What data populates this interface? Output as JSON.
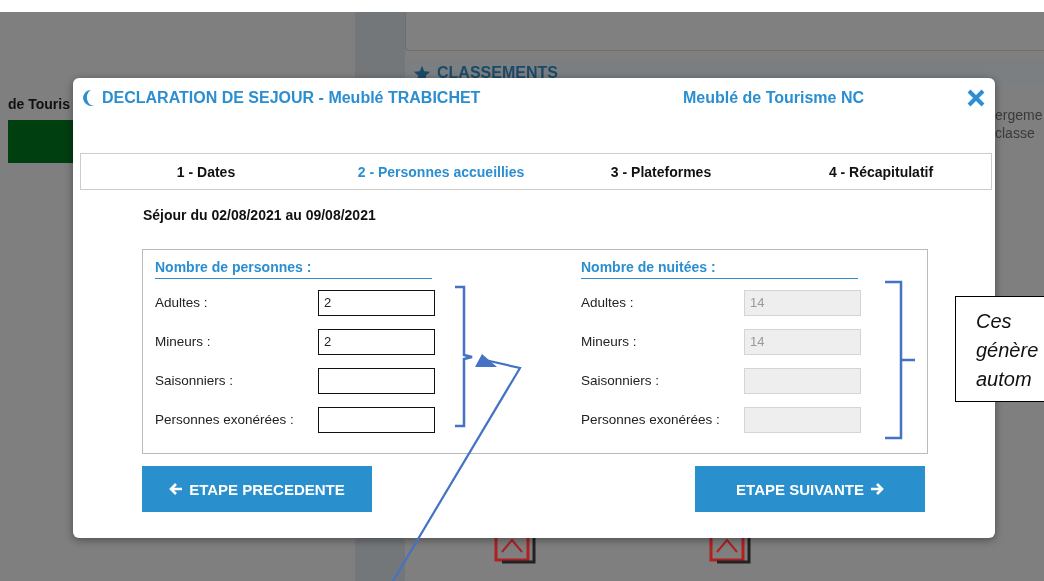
{
  "background": {
    "side_text": "de Touris",
    "section_title": "CLASSEMENTS",
    "side_lines": [
      "ergeme",
      "classe"
    ]
  },
  "dialog": {
    "title": "DECLARATION DE SEJOUR - Meublé TRABICHET",
    "subtitle": "Meublé de Tourisme NC",
    "steps": [
      {
        "label": "1 - Dates",
        "selected": false
      },
      {
        "label": "2 - Personnes accueillies",
        "selected": true
      },
      {
        "label": "3 - Plateformes",
        "selected": false
      },
      {
        "label": "4 - Récapitulatif",
        "selected": false
      }
    ],
    "stay": "Séjour du 02/08/2021 au 09/08/2021",
    "groups": [
      {
        "title": "Nombre de personnes :",
        "disabled": false,
        "fields": [
          {
            "label": "Adultes :",
            "value": "2"
          },
          {
            "label": "Mineurs :",
            "value": "2"
          },
          {
            "label": "Saisonniers :"
          },
          {
            "label": "Personnes exonérées :"
          }
        ]
      },
      {
        "title": "Nombre de nuitées :",
        "disabled": true,
        "fields": [
          {
            "label": "Adultes :",
            "value": "14"
          },
          {
            "label": "Mineurs :",
            "value": "14"
          },
          {
            "label": "Saisonniers :"
          },
          {
            "label": "Personnes exonérées :"
          }
        ]
      }
    ],
    "buttons": [
      {
        "label": "ETAPE PRECEDENTE",
        "kind": "back"
      },
      {
        "label": "ETAPE SUIVANTE",
        "kind": "next"
      }
    ]
  },
  "callout": {
    "lines": [
      "Ces",
      "génère",
      "autom"
    ]
  }
}
